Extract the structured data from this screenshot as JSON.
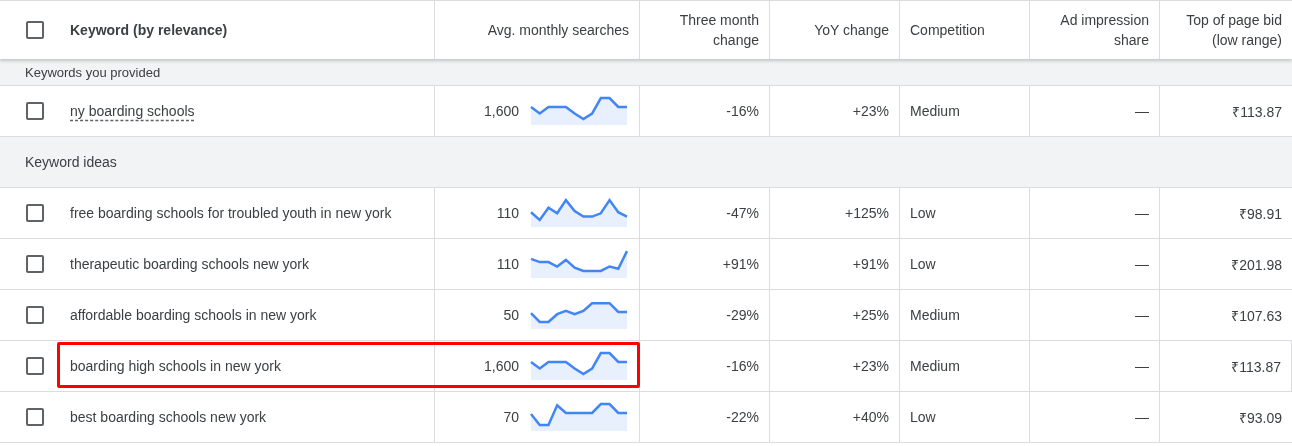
{
  "header": {
    "checked": false,
    "columns": [
      "Keyword (by relevance)",
      "Avg. monthly searches",
      "Three month change",
      "YoY change",
      "Competition",
      "Ad impression share",
      "Top of page bid (low range)"
    ]
  },
  "sections": [
    {
      "label": "Keywords you provided",
      "rows": [
        {
          "checked": false,
          "underlined": true,
          "highlighted": false,
          "keyword": "ny boarding schools",
          "searches": "1,600",
          "three_month": "-16%",
          "yoy": "+23%",
          "competition": "Medium",
          "ad_share": "—",
          "bid": "₹113.87"
        }
      ]
    },
    {
      "label": "Keyword ideas",
      "rows": [
        {
          "checked": false,
          "underlined": false,
          "highlighted": false,
          "keyword": "free boarding schools for troubled youth in new york",
          "searches": "110",
          "three_month": "-47%",
          "yoy": "+125%",
          "competition": "Low",
          "ad_share": "—",
          "bid": "₹98.91"
        },
        {
          "checked": false,
          "underlined": false,
          "highlighted": false,
          "keyword": "therapeutic boarding schools new york",
          "searches": "110",
          "three_month": "+91%",
          "yoy": "+91%",
          "competition": "Low",
          "ad_share": "—",
          "bid": "₹201.98"
        },
        {
          "checked": false,
          "underlined": false,
          "highlighted": false,
          "keyword": "affordable boarding schools in new york",
          "searches": "50",
          "three_month": "-29%",
          "yoy": "+25%",
          "competition": "Medium",
          "ad_share": "—",
          "bid": "₹107.63"
        },
        {
          "checked": false,
          "underlined": false,
          "highlighted": true,
          "keyword": "boarding high schools in new york",
          "searches": "1,600",
          "three_month": "-16%",
          "yoy": "+23%",
          "competition": "Medium",
          "ad_share": "—",
          "bid": "₹113.87"
        },
        {
          "checked": false,
          "underlined": false,
          "highlighted": false,
          "keyword": "best boarding schools new york",
          "searches": "70",
          "three_month": "-22%",
          "yoy": "+40%",
          "competition": "Low",
          "ad_share": "—",
          "bid": "₹93.09"
        }
      ]
    }
  ]
}
